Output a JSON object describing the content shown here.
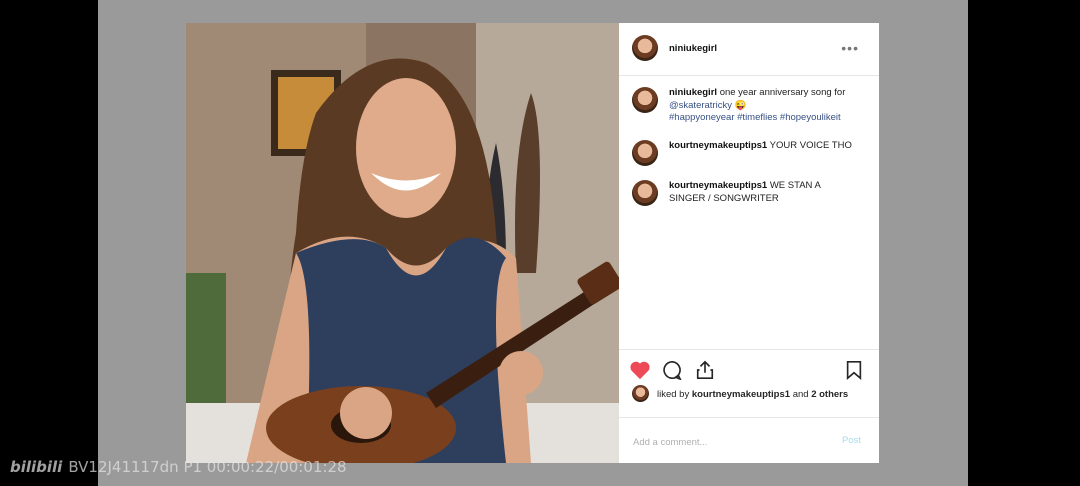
{
  "post": {
    "username": "niniukegirl",
    "more_icon": "more-horizontal-icon",
    "caption": {
      "username": "niniukegirl",
      "text": "one year anniversary song for",
      "mention": "@skateratricky",
      "emoji": "😜",
      "hashtags": [
        "#happyoneyear",
        "#timeflies",
        "#hopeyoulikeit"
      ]
    },
    "comments": [
      {
        "username": "kourtneymakeuptips1",
        "text": "YOUR VOICE THO"
      },
      {
        "username": "kourtneymakeuptips1",
        "text": "WE STAN A SINGER / SONGWRITER"
      }
    ],
    "actions": {
      "like_icon": "heart-filled-icon",
      "comment_icon": "comment-icon",
      "share_icon": "share-icon",
      "save_icon": "bookmark-icon"
    },
    "likes": {
      "prefix": "liked by",
      "user": "kourtneymakeuptips1",
      "middle": "and",
      "others": "2 others"
    },
    "add_comment": {
      "placeholder": "Add a comment...",
      "post_label": "Post"
    },
    "colors": {
      "like": "#ed4956",
      "link": "#385185",
      "post": "#a6ddeb"
    }
  },
  "watermark": {
    "logo": "bilibili",
    "text": "BV12J41117dn P1 00:00:22/00:01:28"
  }
}
